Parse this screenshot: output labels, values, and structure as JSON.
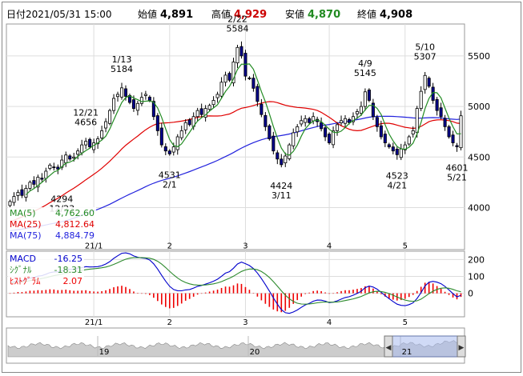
{
  "header": {
    "date_label": "日付",
    "date": "2021/05/31 15:00",
    "open_label": "始値",
    "open": "4,891",
    "high_label": "高値",
    "high": "4,929",
    "low_label": "安値",
    "low": "4,870",
    "close_label": "終値",
    "close": "4,908"
  },
  "legend": {
    "ma5_label": "MA(5)",
    "ma5_value": "4,762.60",
    "ma25_label": "MA(25)",
    "ma25_value": "4,812.64",
    "ma75_label": "MA(75)",
    "ma75_value": "4,884.79",
    "macd_label": "MACD",
    "macd_value": "-16.25",
    "signal_label": "ｼｸﾞﾅﾙ",
    "signal_value": "-18.31",
    "hist_label": "ﾋｽﾄｸﾞﾗﾑ",
    "hist_value": "2.07"
  },
  "colors": {
    "up": "#ffffff",
    "down": "#00008b",
    "ma5": "#228b22",
    "ma25": "#e00000",
    "ma75": "#2222dd",
    "macd": "#0000cc",
    "signal": "#2e8b2e",
    "hist": "#ee0000",
    "high_text": "#cc0000",
    "low_text": "#228b22"
  },
  "chart_data": {
    "type": "candlestick",
    "y_ticks": [
      "5500",
      "5000",
      "4500",
      "4000"
    ],
    "ylim": [
      3600,
      5800
    ],
    "x_ticks": [
      {
        "label": "21/1",
        "index": 21
      },
      {
        "label": "2",
        "index": 40
      },
      {
        "label": "3",
        "index": 59
      },
      {
        "label": "4",
        "index": 80
      },
      {
        "label": "5",
        "index": 99
      }
    ],
    "n_days": 114,
    "closes": [
      4060,
      4110,
      4150,
      4120,
      4190,
      4250,
      4230,
      4300,
      4280,
      4360,
      4420,
      4400,
      4380,
      4470,
      4520,
      4480,
      4500,
      4560,
      4620,
      4656,
      4600,
      4640,
      4680,
      4760,
      4850,
      4960,
      5080,
      5120,
      5184,
      5100,
      5040,
      4980,
      5030,
      5090,
      5120,
      5060,
      4900,
      4760,
      4620,
      4560,
      4531,
      4600,
      4700,
      4760,
      4840,
      4820,
      4900,
      4960,
      4920,
      4980,
      5010,
      5060,
      5120,
      5240,
      5310,
      5260,
      5440,
      5584,
      5500,
      5300,
      5280,
      5180,
      5050,
      4920,
      4800,
      4680,
      4560,
      4480,
      4424,
      4510,
      4620,
      4740,
      4800,
      4860,
      4880,
      4840,
      4900,
      4850,
      4780,
      4700,
      4640,
      4760,
      4820,
      4860,
      4880,
      4840,
      4900,
      4950,
      5000,
      5145,
      5060,
      4900,
      4800,
      4700,
      4640,
      4600,
      4560,
      4523,
      4580,
      4620,
      4700,
      4760,
      4980,
      5150,
      5307,
      5200,
      5060,
      4960,
      4900,
      4800,
      4700,
      4640,
      4601,
      4908
    ],
    "volume_scroll_labels": [
      "19",
      "20",
      "21"
    ],
    "macd_ticks": [
      "200",
      "100",
      "0"
    ],
    "annotations": [
      {
        "index": 19,
        "price": 4656,
        "date": "12/21",
        "pos": "above"
      },
      {
        "index": 28,
        "price": 5184,
        "date": "1/13",
        "pos": "above"
      },
      {
        "index": 40,
        "price": 4531,
        "date": "2/1",
        "pos": "below"
      },
      {
        "index": 57,
        "price": 5584,
        "date": "2/22",
        "pos": "above"
      },
      {
        "index": 68,
        "price": 4424,
        "date": "3/11",
        "pos": "below"
      },
      {
        "index": 89,
        "price": 5145,
        "date": "4/9",
        "pos": "above"
      },
      {
        "index": 97,
        "price": 4523,
        "date": "4/21",
        "pos": "below"
      },
      {
        "index": 104,
        "price": 5307,
        "date": "5/10",
        "pos": "above"
      },
      {
        "index": 112,
        "price": 4601,
        "date": "5/21",
        "pos": "below"
      },
      {
        "index": 13,
        "price": 4294,
        "date": "12/23",
        "pos": "below"
      }
    ]
  }
}
